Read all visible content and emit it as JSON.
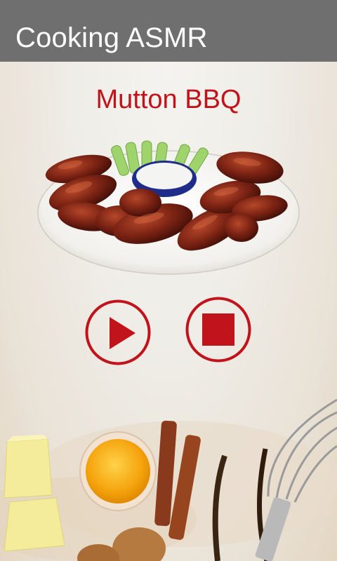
{
  "app": {
    "title": "Cooking ASMR"
  },
  "recipe": {
    "name": "Mutton BBQ"
  },
  "controls": {
    "play_icon": "play-icon",
    "stop_icon": "stop-icon"
  },
  "colors": {
    "appbar": "#6f6f6f",
    "accent_red": "#c1131b",
    "background": "#efeeea"
  }
}
